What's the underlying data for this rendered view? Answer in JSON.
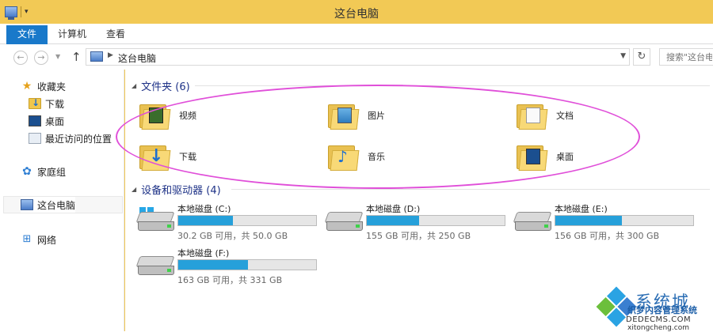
{
  "window": {
    "title": "这台电脑",
    "colors": {
      "titlebar": "#f2c955",
      "accent": "#1979ca",
      "highlight": "#e04fd9",
      "bar_fill": "#26a0da"
    }
  },
  "ribbon": {
    "tabs": [
      "文件",
      "计算机",
      "查看"
    ]
  },
  "address": {
    "path": "这台电脑",
    "search_placeholder": "搜索\"这台电"
  },
  "nav": {
    "favorites": {
      "label": "收藏夹",
      "items": [
        "下载",
        "桌面",
        "最近访问的位置"
      ]
    },
    "homegroup": "家庭组",
    "this_pc": "这台电脑",
    "network": "网络"
  },
  "folders": {
    "header": "文件夹 (6)",
    "items": [
      {
        "label": "视频",
        "icon": "video-folder-icon"
      },
      {
        "label": "图片",
        "icon": "pictures-folder-icon"
      },
      {
        "label": "文档",
        "icon": "documents-folder-icon"
      },
      {
        "label": "下载",
        "icon": "downloads-folder-icon"
      },
      {
        "label": "音乐",
        "icon": "music-folder-icon"
      },
      {
        "label": "桌面",
        "icon": "desktop-folder-icon"
      }
    ]
  },
  "drives": {
    "header": "设备和驱动器 (4)",
    "items": [
      {
        "name": "本地磁盘 (C:)",
        "info": "30.2 GB 可用，共 50.0 GB",
        "used_fraction": 0.396
      },
      {
        "name": "本地磁盘 (D:)",
        "info": "155 GB 可用，共 250 GB",
        "used_fraction": 0.38
      },
      {
        "name": "本地磁盘 (E:)",
        "info": "156 GB 可用，共 300 GB",
        "used_fraction": 0.48
      },
      {
        "name": "本地磁盘 (F:)",
        "info": "163 GB 可用，共 331 GB",
        "used_fraction": 0.508
      }
    ]
  },
  "watermark": {
    "brand": "系统城",
    "line1": "织梦内容管理系统",
    "line2": "DEDECMS.COM",
    "line3": "xitongcheng.com"
  }
}
